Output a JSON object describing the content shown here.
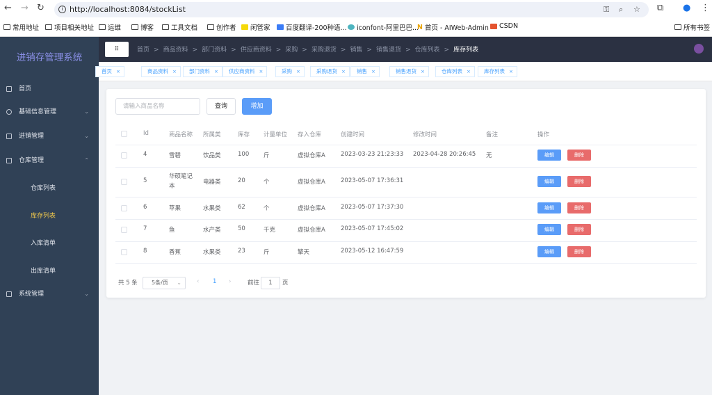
{
  "browser": {
    "url": "http://localhost:8084/stockList",
    "bookmarks": [
      "常用地址",
      "项目相关地址",
      "运维",
      "博客",
      "工具文档",
      "创作者",
      "闲管家",
      "百度翻译-200种语...",
      "iconfont-阿里巴巴...",
      "首页 - AIWeb-Admin",
      "CSDN"
    ],
    "all_bookmarks": "所有书签"
  },
  "sidebar": {
    "title": "进销存管理系统",
    "items": [
      {
        "label": "首页"
      },
      {
        "label": "基础信息管理"
      },
      {
        "label": "进销管理"
      },
      {
        "label": "仓库管理"
      },
      {
        "label": "仓库列表"
      },
      {
        "label": "库存列表"
      },
      {
        "label": "入库清单"
      },
      {
        "label": "出库清单"
      },
      {
        "label": "系统管理"
      }
    ]
  },
  "header": {
    "breadcrumbs": [
      "首页",
      "商品资料",
      "部门资料",
      "供应商资料",
      "采购",
      "采购退货",
      "销售",
      "销售退货",
      "仓库列表",
      "库存列表"
    ]
  },
  "tags": [
    "首页",
    "商品资料",
    "部门资料",
    "供应商资料",
    "采购",
    "采购退货",
    "销售",
    "销售退货",
    "仓库列表",
    "库存列表"
  ],
  "toolbar": {
    "search_placeholder": "请输入商品名称",
    "query": "查询",
    "add": "增加"
  },
  "table": {
    "headers": [
      "Id",
      "商品名称",
      "所属类",
      "库存",
      "计量单位",
      "存入仓库",
      "创建时间",
      "修改时间",
      "备注",
      "操作"
    ],
    "rows": [
      [
        "4",
        "雪碧",
        "饮品类",
        "100",
        "斤",
        "虚拟仓库A",
        "2023-03-23 21:23:33",
        "2023-04-28 20:26:45",
        "无"
      ],
      [
        "5",
        "华硕笔记本",
        "电器类",
        "20",
        "个",
        "虚拟仓库A",
        "2023-05-07 17:36:31",
        "",
        ""
      ],
      [
        "6",
        "苹果",
        "水果类",
        "62",
        "个",
        "虚拟仓库A",
        "2023-05-07 17:37:30",
        "",
        ""
      ],
      [
        "7",
        "鱼",
        "水产类",
        "50",
        "千克",
        "虚拟仓库A",
        "2023-05-07 17:45:02",
        "",
        ""
      ],
      [
        "8",
        "香蕉",
        "水果类",
        "23",
        "斤",
        "擎天",
        "2023-05-12 16:47:59",
        "",
        ""
      ]
    ],
    "edit": "编辑",
    "delete": "删除"
  },
  "pagination": {
    "total": "共 5 条",
    "page_size": "5条/页",
    "current": "1",
    "goto": "前往",
    "goto_value": "1",
    "page_suffix": "页"
  }
}
